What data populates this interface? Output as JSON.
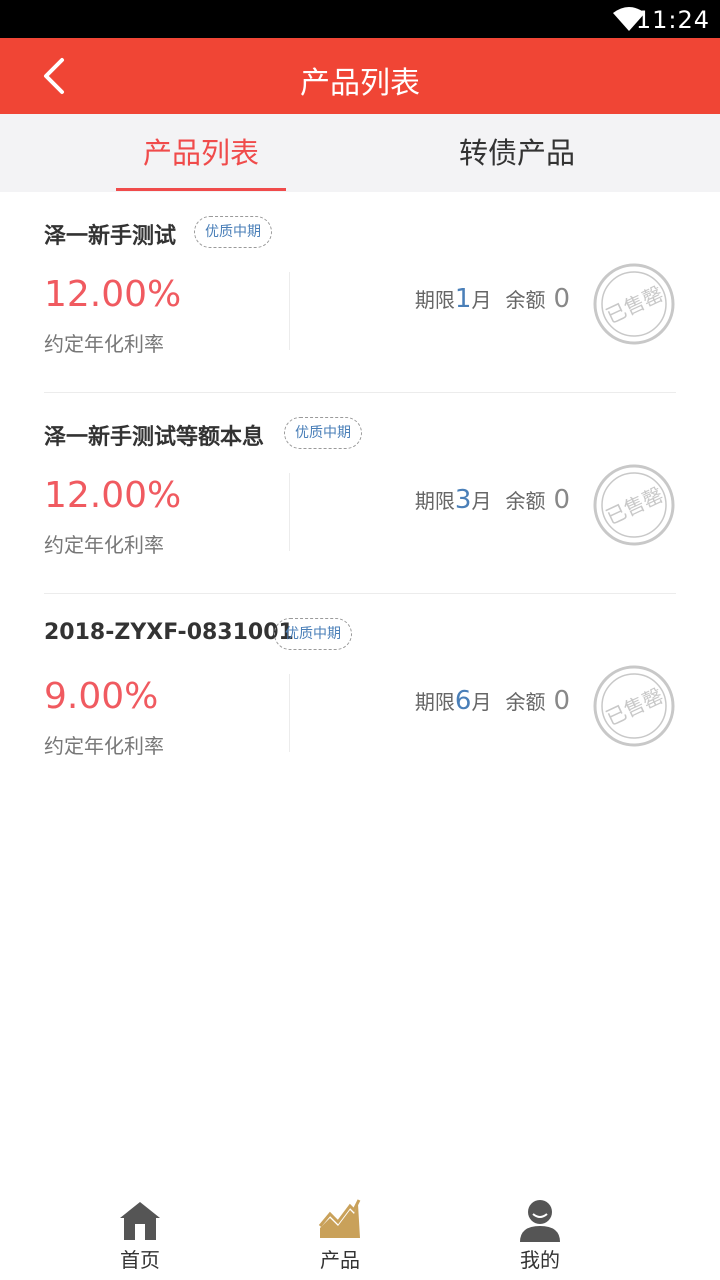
{
  "status_bar": {
    "time": "11:24"
  },
  "header": {
    "title": "产品列表"
  },
  "tabs": [
    {
      "label": "产品列表",
      "active": true
    },
    {
      "label": "转债产品",
      "active": false
    }
  ],
  "products": [
    {
      "name": "泽一新手测试",
      "tag": "优质中期",
      "rate": "12.00%",
      "rate_label": "约定年化利率",
      "term_prefix": "期限",
      "term_value": "1",
      "term_unit": "月",
      "remain_label": "余额",
      "remain_value": "0",
      "status": "已售罄"
    },
    {
      "name": "泽一新手测试等额本息",
      "tag": "优质中期",
      "rate": "12.00%",
      "rate_label": "约定年化利率",
      "term_prefix": "期限",
      "term_value": "3",
      "term_unit": "月",
      "remain_label": "余额",
      "remain_value": "0",
      "status": "已售罄"
    },
    {
      "name": "2018-ZYXF-0831001",
      "tag": "优质中期",
      "rate": "9.00%",
      "rate_label": "约定年化利率",
      "term_prefix": "期限",
      "term_value": "6",
      "term_unit": "月",
      "remain_label": "余额",
      "remain_value": "0",
      "status": "已售罄"
    }
  ],
  "tabbar": [
    {
      "label": "首页",
      "icon": "home-icon",
      "color": "#555555"
    },
    {
      "label": "产品",
      "icon": "chart-icon",
      "color": "#c9a15a"
    },
    {
      "label": "我的",
      "icon": "user-icon",
      "color": "#555555"
    }
  ],
  "colors": {
    "accent": "#f04535",
    "rate": "#f05a60",
    "term": "#4a7fb8"
  }
}
